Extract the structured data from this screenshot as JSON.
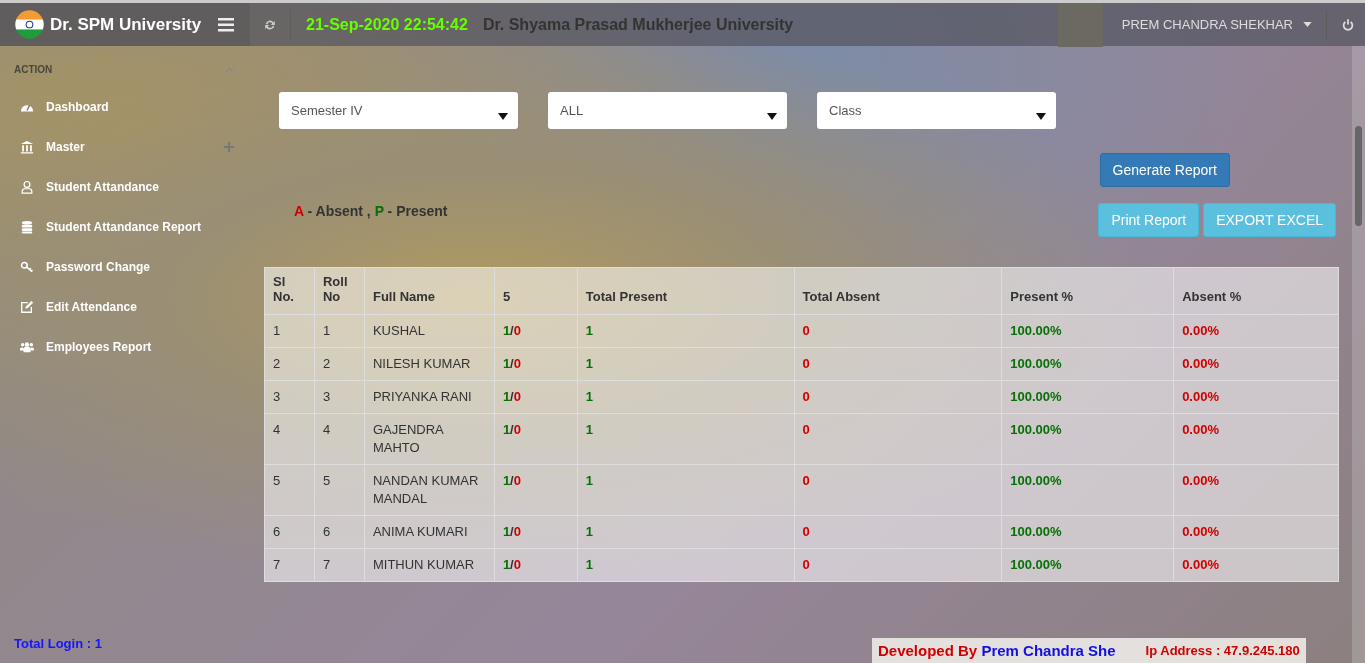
{
  "header": {
    "brand": "Dr. SPM University",
    "datetime": "21-Sep-2020 22:54:42",
    "title": "Dr. Shyama Prasad Mukherjee University",
    "user": "PREM CHANDRA SHEKHAR"
  },
  "sidebar": {
    "section": "ACTION",
    "items": [
      {
        "label": "Dashboard",
        "expandable": false
      },
      {
        "label": "Master",
        "expandable": true
      },
      {
        "label": "Student Attandance",
        "expandable": false
      },
      {
        "label": "Student Attandance Report",
        "expandable": false
      },
      {
        "label": "Password Change",
        "expandable": false
      },
      {
        "label": "Edit Attendance",
        "expandable": false
      },
      {
        "label": "Employees Report",
        "expandable": false
      }
    ],
    "total_login": "Total Login : 1"
  },
  "filters": [
    {
      "value": "Semester IV"
    },
    {
      "value": "ALL"
    },
    {
      "value": "Class"
    }
  ],
  "buttons": {
    "generate": "Generate Report",
    "print": "Print Report",
    "export": "EXPORT EXCEL"
  },
  "legend": [
    {
      "text": "A",
      "kind": "absent"
    },
    {
      "text": " - Absent , ",
      "kind": "plain"
    },
    {
      "text": "P",
      "kind": "present"
    },
    {
      "text": " - Present",
      "kind": "plain"
    }
  ],
  "table": {
    "columns": [
      "Sl No.",
      "Roll No",
      "Full Name",
      "5",
      "Total Present",
      "Total Absent",
      "Present %",
      "Absent %"
    ],
    "rows": [
      {
        "sl": "1",
        "roll": "1",
        "name": "KUSHAL",
        "day": {
          "present": "1",
          "sep": "/",
          "absent": "0"
        },
        "total_present": "1",
        "total_absent": "0",
        "present_pct": "100.00%",
        "absent_pct": "0.00%"
      },
      {
        "sl": "2",
        "roll": "2",
        "name": "NILESH KUMAR",
        "day": {
          "present": "1",
          "sep": "/",
          "absent": "0"
        },
        "total_present": "1",
        "total_absent": "0",
        "present_pct": "100.00%",
        "absent_pct": "0.00%"
      },
      {
        "sl": "3",
        "roll": "3",
        "name": "PRIYANKA RANI",
        "day": {
          "present": "1",
          "sep": "/",
          "absent": "0"
        },
        "total_present": "1",
        "total_absent": "0",
        "present_pct": "100.00%",
        "absent_pct": "0.00%"
      },
      {
        "sl": "4",
        "roll": "4",
        "name": "GAJENDRA MAHTO",
        "day": {
          "present": "1",
          "sep": "/",
          "absent": "0"
        },
        "total_present": "1",
        "total_absent": "0",
        "present_pct": "100.00%",
        "absent_pct": "0.00%"
      },
      {
        "sl": "5",
        "roll": "5",
        "name": "NANDAN KUMAR MANDAL",
        "day": {
          "present": "1",
          "sep": "/",
          "absent": "0"
        },
        "total_present": "1",
        "total_absent": "0",
        "present_pct": "100.00%",
        "absent_pct": "0.00%"
      },
      {
        "sl": "6",
        "roll": "6",
        "name": "ANIMA KUMARI",
        "day": {
          "present": "1",
          "sep": "/",
          "absent": "0"
        },
        "total_present": "1",
        "total_absent": "0",
        "present_pct": "100.00%",
        "absent_pct": "0.00%"
      },
      {
        "sl": "7",
        "roll": "7",
        "name": "MITHUN KUMAR",
        "day": {
          "present": "1",
          "sep": "/",
          "absent": "0"
        },
        "total_present": "1",
        "total_absent": "0",
        "present_pct": "100.00%",
        "absent_pct": "0.00%"
      }
    ]
  },
  "footer": {
    "developer": [
      {
        "text": "Developed By ",
        "kind": "label"
      },
      {
        "text": "Prem Chandra She",
        "kind": "name"
      }
    ],
    "ip": "Ip Address : 47.9.245.180"
  }
}
